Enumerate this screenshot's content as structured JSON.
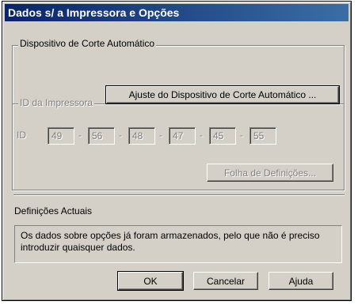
{
  "dialog": {
    "title": "Dados s/ a Impressora e Opções"
  },
  "cutter_group": {
    "legend": "Dispositivo de Corte Automático",
    "button_label": "Ajuste do Dispositivo de Corte Automático ..."
  },
  "printer_id_group": {
    "legend": "ID da Impressora",
    "id_label": "ID",
    "separator": "-",
    "values": [
      "49",
      "56",
      "48",
      "47",
      "45",
      "55"
    ],
    "sheet_button_label": "Folha de Definições..."
  },
  "current_settings": {
    "heading": "Definições Actuais",
    "message": "Os dados sobre opções já foram armazenados, pelo que não é preciso introduzir quaisquer dados."
  },
  "footer": {
    "ok_label": "OK",
    "cancel_label": "Cancelar",
    "help_label": "Ajuda"
  }
}
